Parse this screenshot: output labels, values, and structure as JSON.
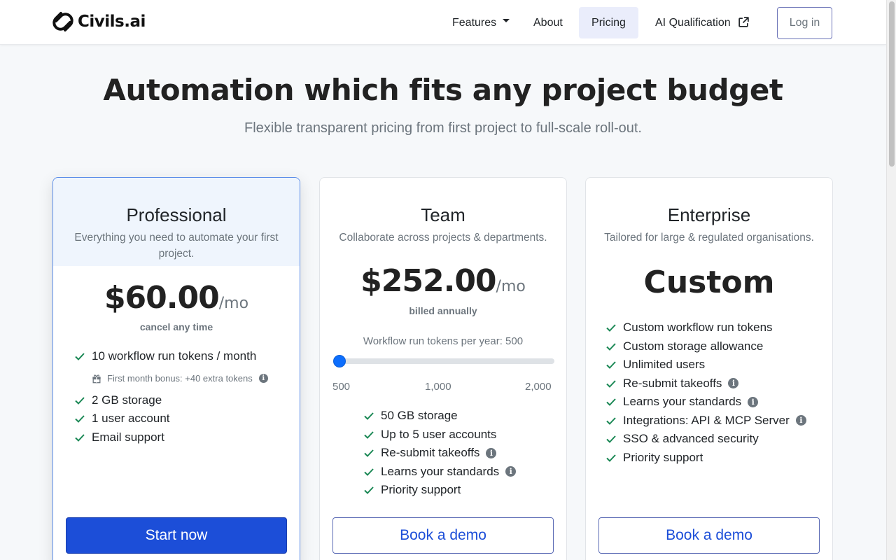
{
  "brand": {
    "name": "Civils.ai"
  },
  "nav": {
    "features": "Features",
    "about": "About",
    "pricing": "Pricing",
    "ai_qualification": "AI Qualification",
    "login": "Log in"
  },
  "hero": {
    "title": "Automation which fits any project budget",
    "subtitle": "Flexible transparent pricing from first project to full-scale roll-out."
  },
  "plans": [
    {
      "name": "Professional",
      "description": "Everything you need to automate your first project.",
      "price": "$60.00",
      "per": "/mo",
      "note": "cancel any time",
      "features": [
        "10 workflow run tokens / month",
        "2 GB storage",
        "1 user account",
        "Email support"
      ],
      "bonus": "First month bonus: +40 extra tokens",
      "cta": "Start now"
    },
    {
      "name": "Team",
      "description": "Collaborate across projects & departments.",
      "price": "$252.00",
      "per": "/mo",
      "note": "billed annually",
      "slider": {
        "label": "Workflow run tokens per year: 500",
        "value": 500,
        "min": 500,
        "max": 2000,
        "ticks": [
          "500",
          "1,000",
          "2,000"
        ]
      },
      "features": [
        "50 GB storage",
        "Up to 5 user accounts",
        "Re-submit takeoffs",
        "Learns your standards",
        "Priority support"
      ],
      "cta": "Book a demo"
    },
    {
      "name": "Enterprise",
      "description": "Tailored for large & regulated organisations.",
      "price": "Custom",
      "features": [
        "Custom workflow run tokens",
        "Custom storage allowance",
        "Unlimited users",
        "Re-submit takeoffs",
        "Learns your standards",
        "Integrations: API & MCP Server",
        "SSO & advanced security",
        "Priority support"
      ],
      "cta": "Book a demo"
    }
  ],
  "colors": {
    "accent": "#1c4ed8",
    "check": "#198754",
    "featured_border": "#5b8de8"
  }
}
